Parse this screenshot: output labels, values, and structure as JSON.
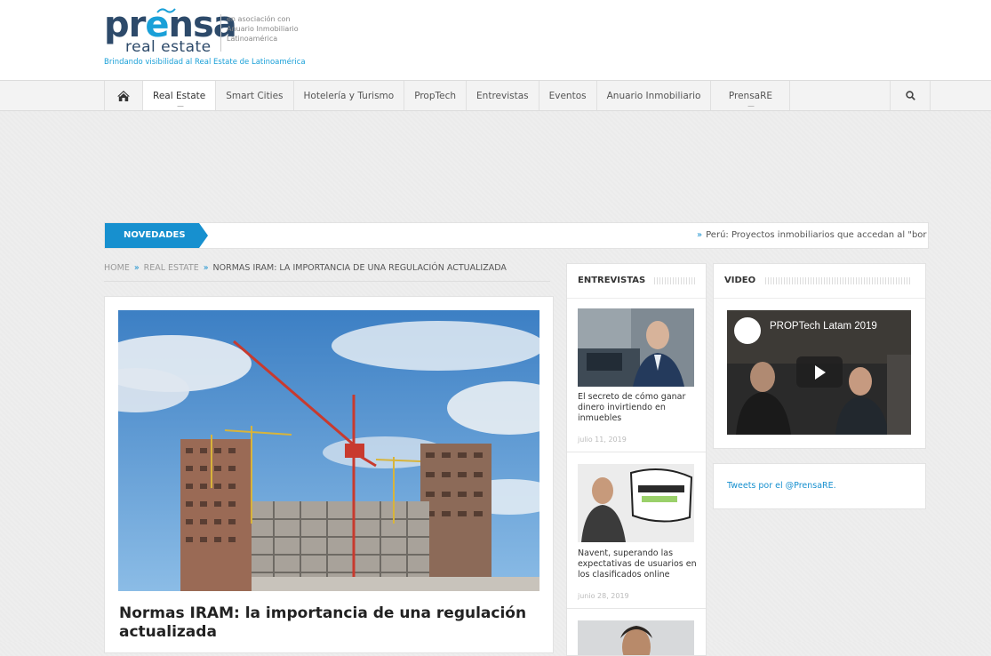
{
  "header": {
    "logo_word_pr": "pr",
    "logo_word_e": "e",
    "logo_word_rest": "nsa",
    "logo_sub": "real estate",
    "assoc_line1": "en asociación con",
    "assoc_line2": "Anuario Inmobiliario",
    "assoc_line3": "Latinoamérica",
    "tagline": "Brindando visibilidad al Real Estate de Latinoamérica"
  },
  "nav": {
    "items": [
      {
        "label": "Real Estate",
        "active": true
      },
      {
        "label": "Smart Cities"
      },
      {
        "label": "Hotelería y Turismo"
      },
      {
        "label": "PropTech"
      },
      {
        "label": "Entrevistas"
      },
      {
        "label": "Eventos"
      },
      {
        "label": "Anuario Inmobiliario"
      },
      {
        "label": "PrensaRE"
      }
    ],
    "home_icon": "home-icon",
    "search_icon": "search-icon"
  },
  "ticker": {
    "label": "NOVEDADES",
    "text": "Perú: Proyectos inmobiliarios que accedan al \"bor"
  },
  "breadcrumb": {
    "home": "HOME",
    "section": "REAL ESTATE",
    "current": "NORMAS IRAM: LA IMPORTANCIA DE UNA REGULACIÓN ACTUALIZADA"
  },
  "article": {
    "title": "Normas IRAM: la importancia de una regulación actualizada"
  },
  "entrevistas": {
    "heading": "ENTREVISTAS",
    "items": [
      {
        "title": "El secreto de cómo ganar dinero invirtiendo en inmuebles",
        "date": "julio 11, 2019"
      },
      {
        "title": "Navent, superando las expectativas de usuarios en los clasificados online",
        "date": "junio 28, 2019"
      }
    ]
  },
  "video": {
    "heading": "VIDEO",
    "title": "PROPTech Latam 2019"
  },
  "tweets": {
    "link": "Tweets por el @PrensaRE."
  },
  "colors": {
    "accent": "#1790cf",
    "brand_dark": "#2d4a6a"
  }
}
